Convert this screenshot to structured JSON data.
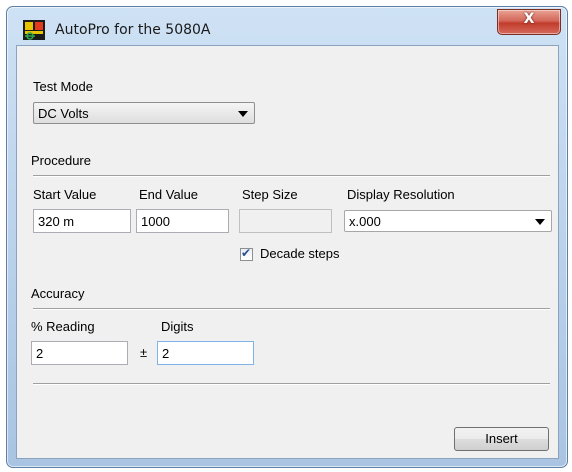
{
  "window": {
    "title": "AutoPro for the 5080A",
    "close_glyph": "X",
    "app_icon": "autopro-app-icon"
  },
  "test_mode": {
    "label": "Test Mode",
    "selected": "DC Volts"
  },
  "procedure": {
    "section_label": "Procedure",
    "start_value": {
      "label": "Start Value",
      "value": "320 m"
    },
    "end_value": {
      "label": "End Value",
      "value": "1000"
    },
    "step_size": {
      "label": "Step Size",
      "value": ""
    },
    "display_resolution": {
      "label": "Display Resolution",
      "selected": "x.000"
    },
    "decade_steps": {
      "label": "Decade steps",
      "checked": true
    }
  },
  "accuracy": {
    "section_label": "Accuracy",
    "reading": {
      "label": "% Reading",
      "value": "2"
    },
    "plus_minus": "±",
    "digits": {
      "label": "Digits",
      "value": "2"
    }
  },
  "actions": {
    "insert_label": "Insert"
  }
}
